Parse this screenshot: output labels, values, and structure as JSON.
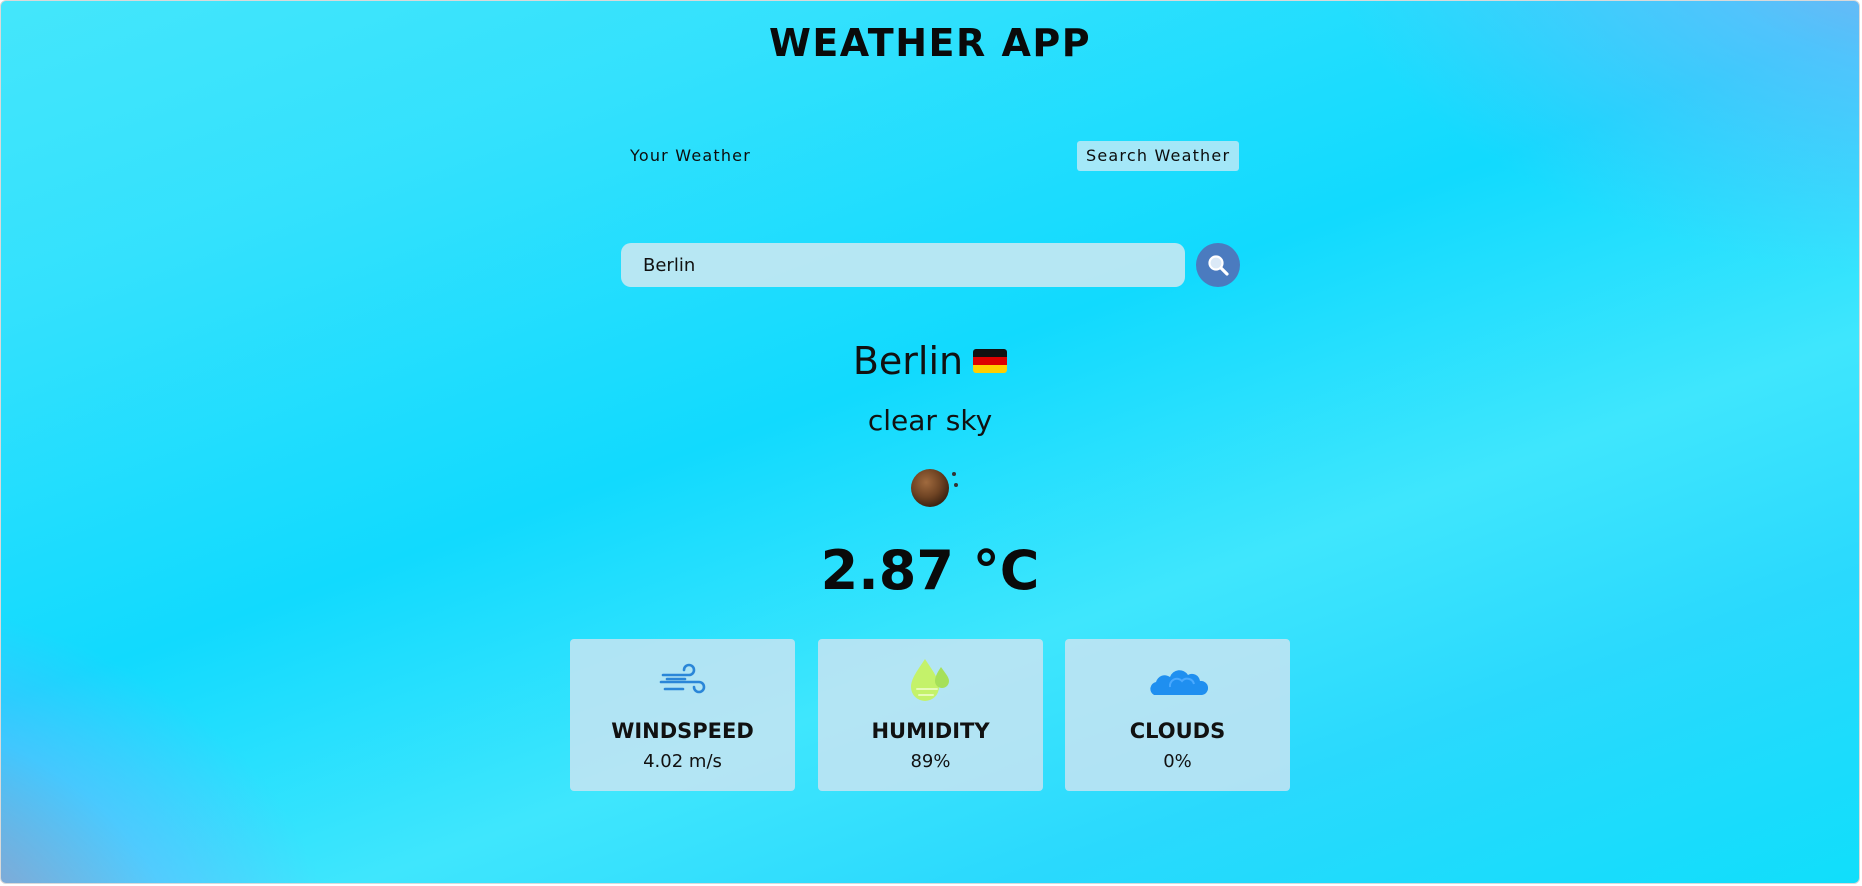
{
  "app": {
    "title": "WEATHER APP"
  },
  "tabs": {
    "your_weather": "Your Weather",
    "search_weather": "Search Weather"
  },
  "search": {
    "value": "Berlin",
    "icon": "search-icon"
  },
  "weather": {
    "city": "Berlin",
    "country_flag": "germany-flag-icon",
    "description": "clear sky",
    "condition_icon": "clear-night-icon",
    "temperature": "2.87 °C"
  },
  "cards": [
    {
      "label": "WINDSPEED",
      "value": "4.02 m/s",
      "icon": "wind-icon"
    },
    {
      "label": "HUMIDITY",
      "value": "89%",
      "icon": "humidity-icon"
    },
    {
      "label": "CLOUDS",
      "value": "0%",
      "icon": "clouds-icon"
    }
  ],
  "colors": {
    "search_button": "#4b7bbf",
    "wind_icon": "#2a86d8",
    "humidity_icon": "#c4f26a",
    "clouds_icon": "#1f8ff0"
  }
}
